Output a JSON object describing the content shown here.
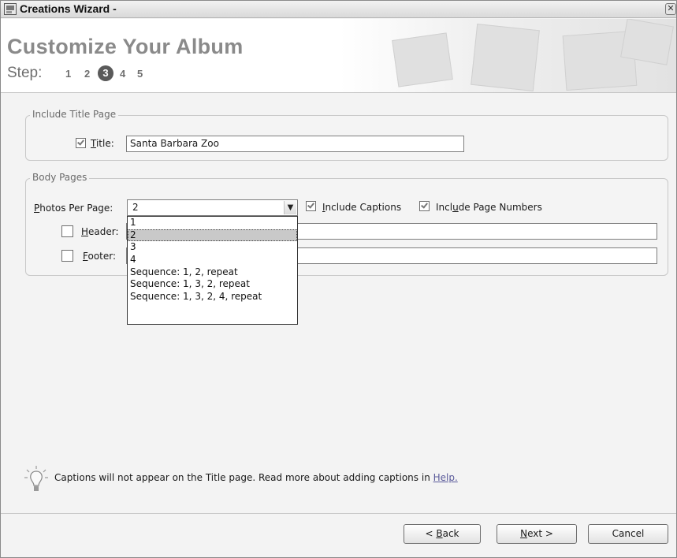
{
  "window": {
    "title": "Creations Wizard -",
    "close_symbol": "✕"
  },
  "header": {
    "title": "Customize Your Album",
    "steps_label": "Step:",
    "steps": [
      "1",
      "2",
      "3",
      "4",
      "5"
    ],
    "current_step": "3"
  },
  "title_page": {
    "legend": "Include Title Page",
    "title_checked": true,
    "title_label_u": "T",
    "title_label_rest": "itle:",
    "title_value": "Santa Barbara Zoo"
  },
  "body_pages": {
    "legend": "Body Pages",
    "photos_label_u": "P",
    "photos_label_rest": "hotos Per Page:",
    "photos_value": "2",
    "include_captions_checked": true,
    "include_captions_u": "I",
    "include_captions_rest": "nclude Captions",
    "include_page_numbers_checked": true,
    "include_page_numbers_pre": "Incl",
    "include_page_numbers_u": "u",
    "include_page_numbers_rest": "de Page Numbers",
    "header_checked": false,
    "header_label_u": "H",
    "header_label_rest": "eader:",
    "header_value": "",
    "footer_checked": false,
    "footer_label_u": "F",
    "footer_label_rest": "ooter:",
    "footer_value": ""
  },
  "photos_dropdown": {
    "options": [
      "1",
      "2",
      "3",
      "4",
      "Sequence: 1, 2, repeat",
      "Sequence: 1, 3, 2, repeat",
      "Sequence: 1, 3, 2, 4, repeat"
    ],
    "selected": "2"
  },
  "hint": {
    "text": "Captions will not appear on the Title page. Read more about adding captions in ",
    "link": "Help."
  },
  "buttons": {
    "back_pre": "< ",
    "back_u": "B",
    "back_rest": "ack",
    "next_u": "N",
    "next_rest": "ext >",
    "cancel": "Cancel"
  }
}
